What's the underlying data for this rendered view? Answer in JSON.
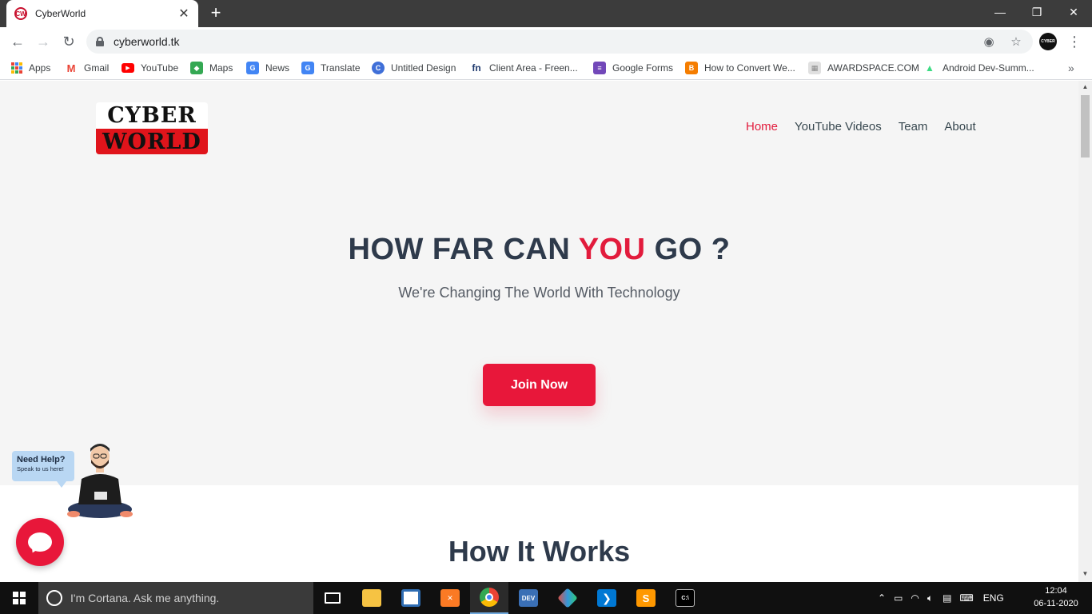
{
  "browser": {
    "tab_title": "CyberWorld",
    "tab_favicon": "CW",
    "url": "cyberworld.tk",
    "profile_text": "CYBER"
  },
  "bookmarks": [
    {
      "label": "Apps",
      "icon": "apps-grid-icon"
    },
    {
      "label": "Gmail",
      "icon": "gmail-icon",
      "color": "#ea4335",
      "glyph": "M"
    },
    {
      "label": "YouTube",
      "icon": "youtube-icon",
      "color": "#ff0000",
      "glyph": "▶"
    },
    {
      "label": "Maps",
      "icon": "maps-icon",
      "color": "#34a853",
      "glyph": "◆"
    },
    {
      "label": "News",
      "icon": "news-icon",
      "color": "#4285f4",
      "glyph": "G"
    },
    {
      "label": "Translate",
      "icon": "translate-icon",
      "color": "#4285f4",
      "glyph": "G"
    },
    {
      "label": "Untitled Design",
      "icon": "canva-icon",
      "color": "#3f6fd8",
      "glyph": "C"
    },
    {
      "label": "Client Area - Freen...",
      "icon": "freenom-icon",
      "color": "#ffffff",
      "glyph": "fn"
    },
    {
      "label": "Google Forms",
      "icon": "forms-icon",
      "color": "#7248b9",
      "glyph": "≡"
    },
    {
      "label": "How to Convert We...",
      "icon": "blogger-icon",
      "color": "#f57d00",
      "glyph": "B"
    },
    {
      "label": "AWARDSPACE.COM",
      "icon": "awardspace-icon",
      "color": "#d8d8d8",
      "glyph": "▦"
    },
    {
      "label": "Android Dev-Summ...",
      "icon": "android-icon",
      "color": "#3ddc84",
      "glyph": "▲"
    }
  ],
  "site": {
    "logo_top": "CYBER",
    "logo_bottom": "WORLD",
    "nav": [
      "Home",
      "YouTube Videos",
      "Team",
      "About"
    ],
    "active_nav": "Home",
    "hero_title_pre": "HOW FAR CAN ",
    "hero_title_accent": "YOU",
    "hero_title_post": " GO ?",
    "hero_subtitle": "We're Changing The World With Technology",
    "cta_label": "Join Now",
    "works_title": "How It Works",
    "help_title": "Need Help?",
    "help_subtitle": "Speak to us here!"
  },
  "colors": {
    "accent": "#e21b3c",
    "heading": "#2e3a4b"
  },
  "taskbar": {
    "search_placeholder": "I'm Cortana. Ask me anything.",
    "language": "ENG",
    "time": "12:04",
    "date": "06-11-2020",
    "apps": [
      {
        "name": "task-view-icon"
      },
      {
        "name": "file-explorer-icon"
      },
      {
        "name": "netbeans-icon"
      },
      {
        "name": "xampp-icon"
      },
      {
        "name": "chrome-icon"
      },
      {
        "name": "devc-icon",
        "glyph": "DEV"
      },
      {
        "name": "git-icon"
      },
      {
        "name": "vscode-icon"
      },
      {
        "name": "sublime-icon",
        "glyph": "S"
      },
      {
        "name": "terminal-icon",
        "glyph": "C:\\"
      }
    ]
  }
}
